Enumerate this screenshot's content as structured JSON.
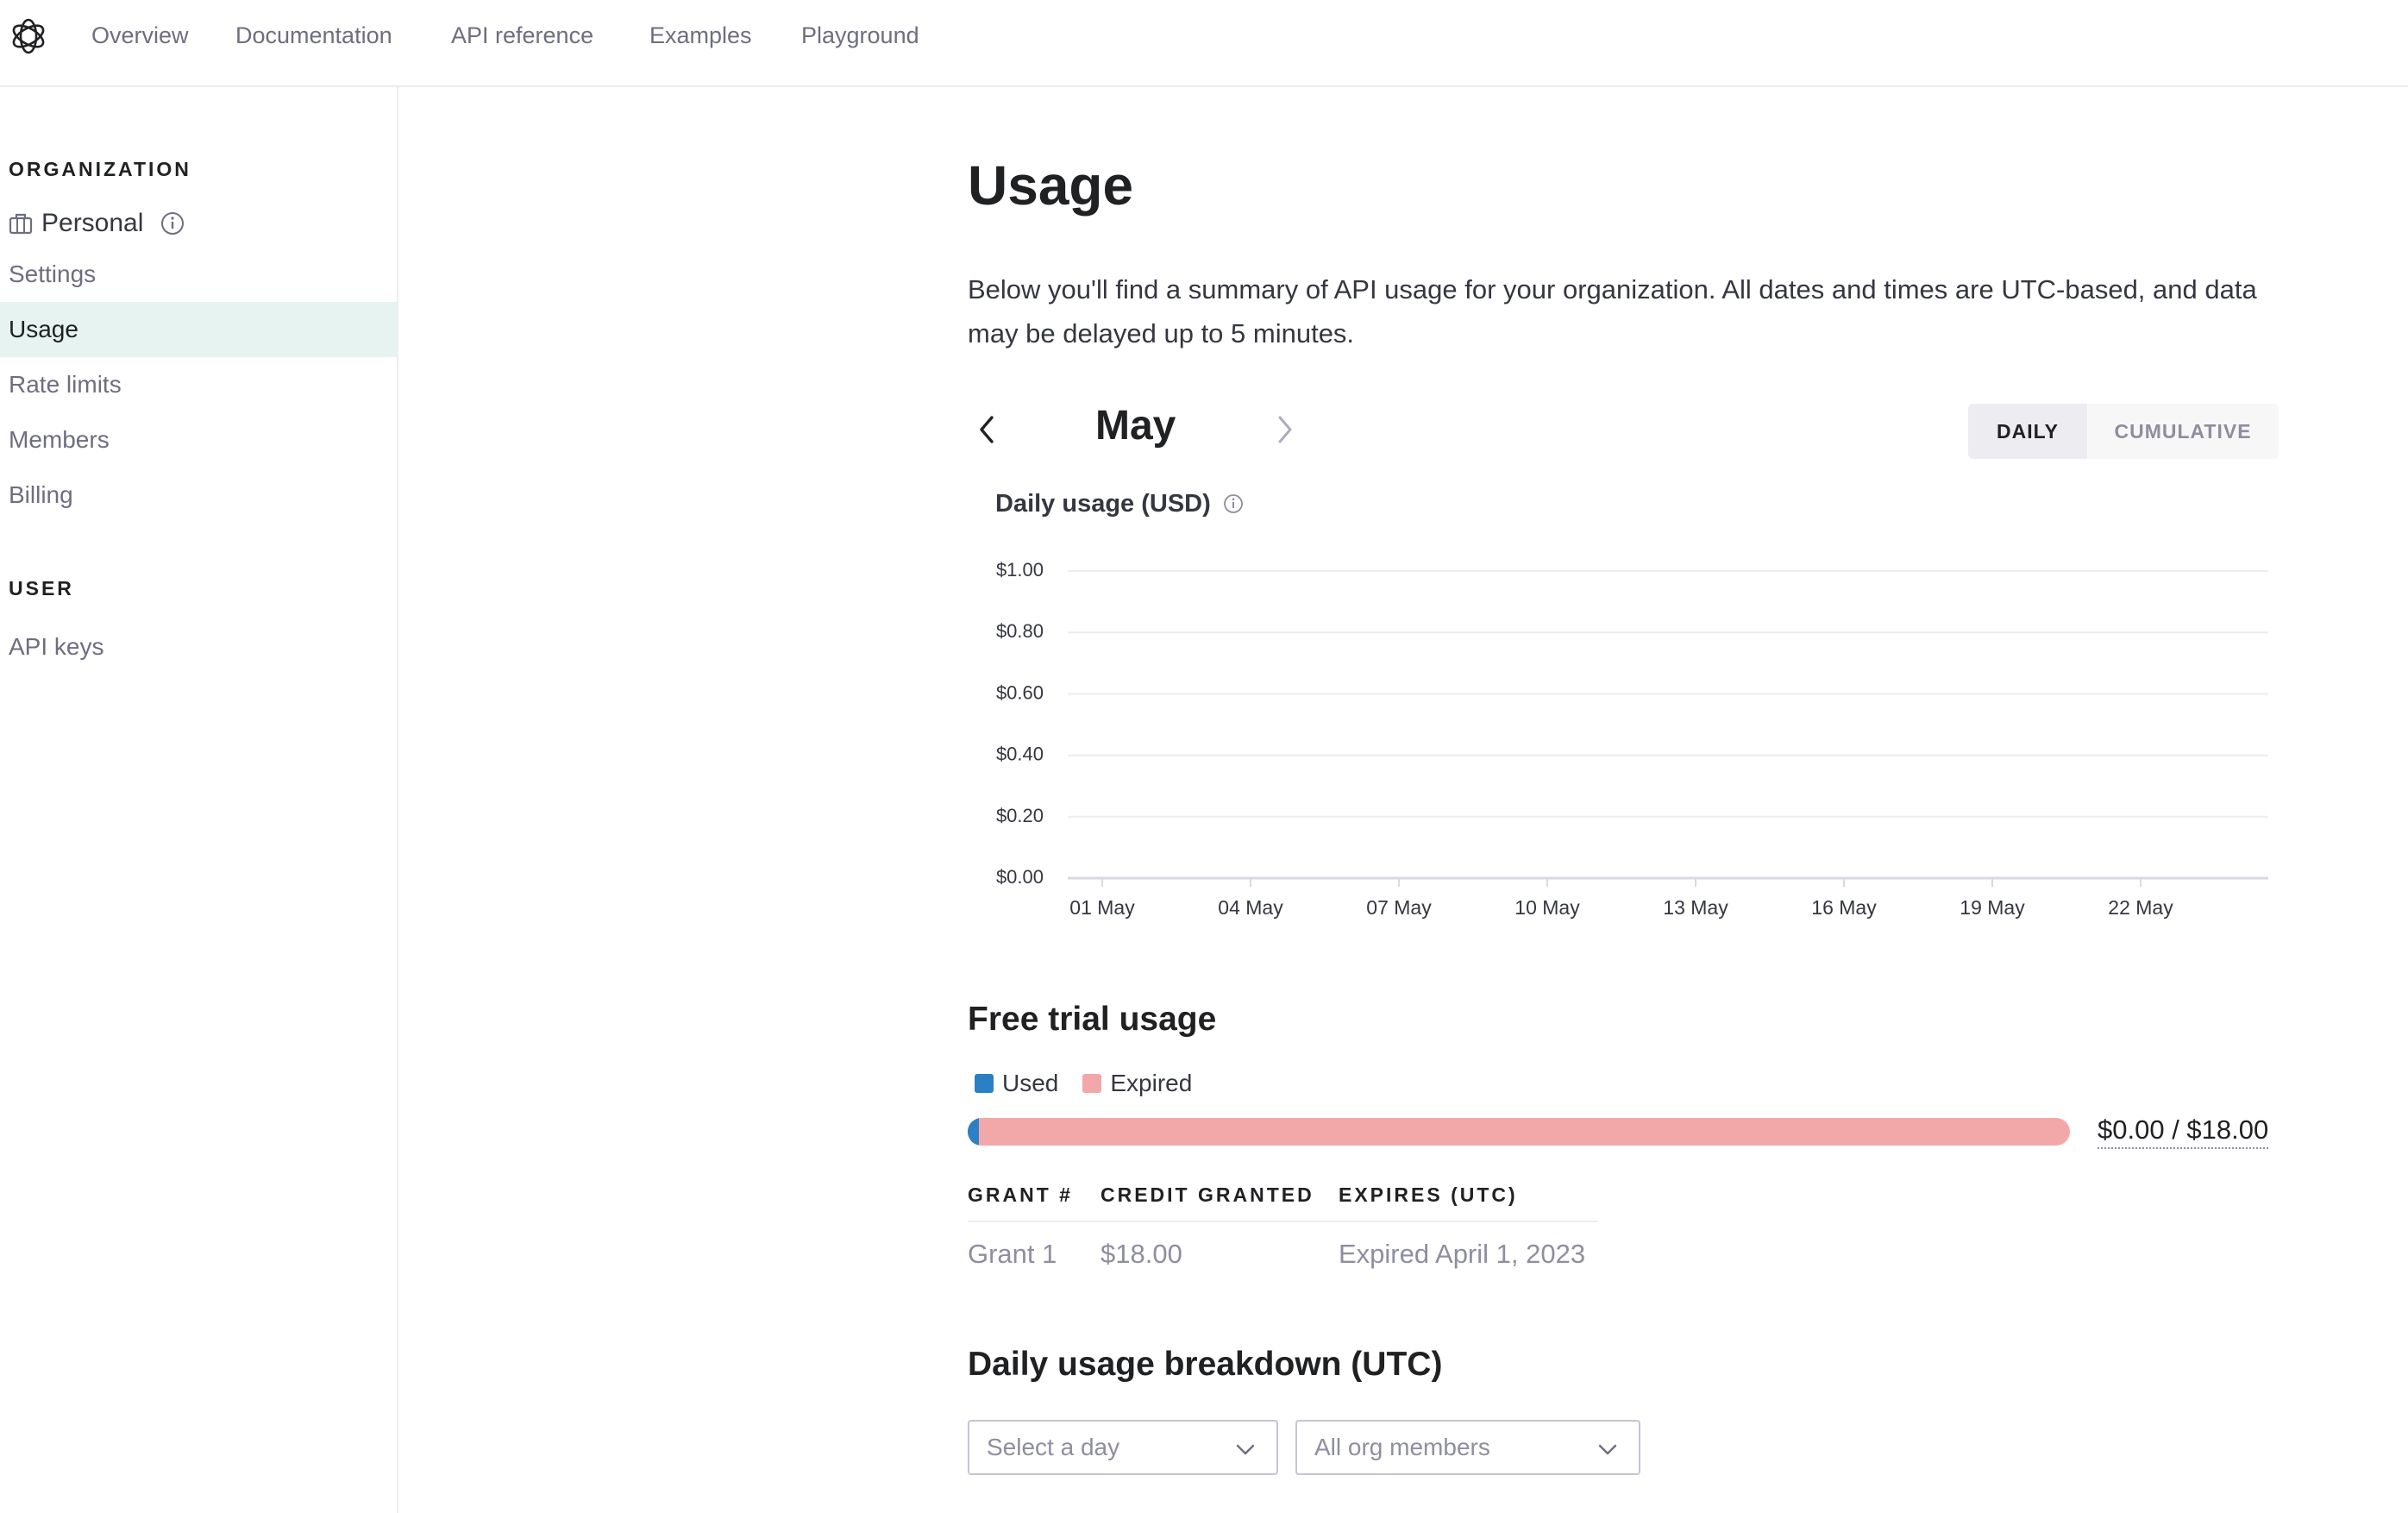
{
  "nav": {
    "items": [
      "Overview",
      "Documentation",
      "API reference",
      "Examples",
      "Playground"
    ]
  },
  "sidebar": {
    "org_heading": "ORGANIZATION",
    "org_name": "Personal",
    "items": [
      "Settings",
      "Usage",
      "Rate limits",
      "Members",
      "Billing"
    ],
    "active_item": "Usage",
    "user_heading": "USER",
    "user_items": [
      "API keys"
    ]
  },
  "page": {
    "title": "Usage",
    "description": "Below you'll find a summary of API usage for your organization. All dates and times are UTC-based, and data may be delayed up to 5 minutes."
  },
  "period": {
    "month": "May",
    "toggle": {
      "daily": "DAILY",
      "cumulative": "CUMULATIVE",
      "selected": "DAILY"
    }
  },
  "chart_data": {
    "type": "bar",
    "title": "Daily usage (USD)",
    "xlabel": "",
    "ylabel": "",
    "ylim": [
      0,
      1
    ],
    "y_ticks": [
      "$0.00",
      "$0.20",
      "$0.40",
      "$0.60",
      "$0.80",
      "$1.00"
    ],
    "x_ticks": [
      "01 May",
      "04 May",
      "07 May",
      "10 May",
      "13 May",
      "16 May",
      "19 May",
      "22 May"
    ],
    "categories": [],
    "values": [],
    "grid": true,
    "colors": {
      "grid": "#ececf1",
      "axis": "#d9d9e3"
    }
  },
  "free_trial": {
    "title": "Free trial usage",
    "legend": [
      {
        "label": "Used",
        "color": "#2b7fc4"
      },
      {
        "label": "Expired",
        "color": "#f2a8a8"
      }
    ],
    "used_fraction": 0.01,
    "total_label": "$0.00 / $18.00",
    "columns": [
      "GRANT #",
      "CREDIT GRANTED",
      "EXPIRES (UTC)"
    ],
    "rows": [
      [
        "Grant 1",
        "$18.00",
        "Expired April 1, 2023"
      ]
    ]
  },
  "breakdown": {
    "title": "Daily usage breakdown (UTC)",
    "day_select_placeholder": "Select a day",
    "member_select_value": "All org members"
  }
}
